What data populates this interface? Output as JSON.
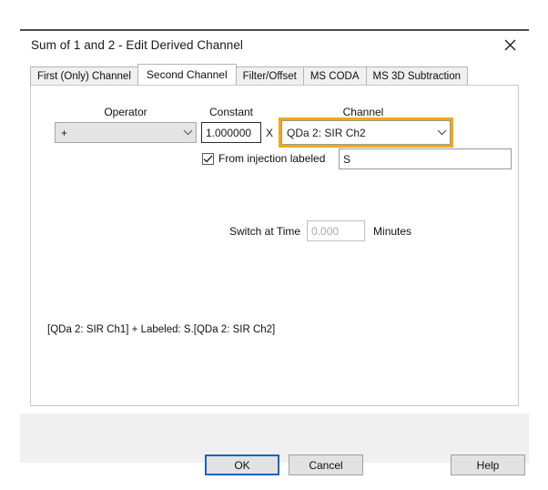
{
  "dialog": {
    "title": "Sum of 1 and 2 - Edit Derived Channel",
    "close_icon": "close-icon"
  },
  "tabs": [
    {
      "label": "First (Only) Channel",
      "active": false
    },
    {
      "label": "Second Channel",
      "active": true
    },
    {
      "label": "Filter/Offset",
      "active": false
    },
    {
      "label": "MS CODA",
      "active": false
    },
    {
      "label": "MS 3D Subtraction",
      "active": false
    }
  ],
  "form": {
    "headers": {
      "operator": "Operator",
      "constant": "Constant",
      "channel": "Channel"
    },
    "operator": {
      "value": "+",
      "options": [
        "+",
        "-",
        "*",
        "/"
      ]
    },
    "constant": {
      "value": "1.000000"
    },
    "multiply_symbol": "X",
    "channel": {
      "value": "QDa 2: SIR Ch2",
      "options": [
        "QDa 2: SIR Ch1",
        "QDa 2: SIR Ch2"
      ],
      "highlight_color": "#f5a800"
    },
    "from_injection": {
      "label": "From injection labeled",
      "checked": true,
      "value": "S"
    },
    "switch_at_time": {
      "label": "Switch at Time",
      "value": "0.000",
      "units": "Minutes",
      "disabled": true
    },
    "formula": "[QDa 2: SIR Ch1] + Labeled: S.[QDa 2: SIR Ch2]"
  },
  "footer": {
    "ok": "OK",
    "cancel": "Cancel",
    "help": "Help",
    "default_button_color": "#0a64c8"
  }
}
